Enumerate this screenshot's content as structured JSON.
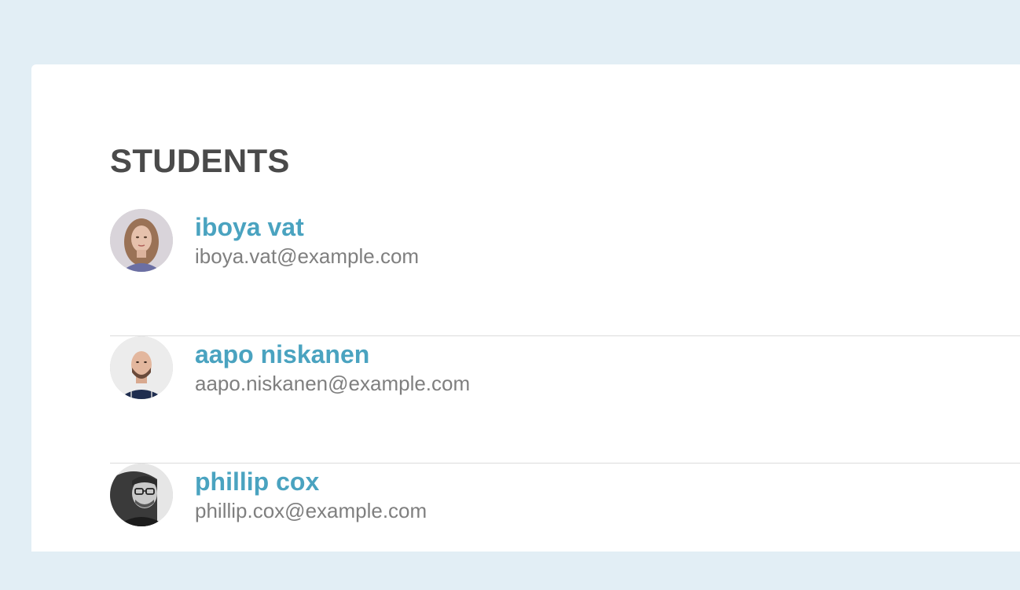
{
  "page": {
    "title": "STUDENTS"
  },
  "students": [
    {
      "name": "iboya vat",
      "email": "iboya.vat@example.com",
      "avatar_icon": "avatar-woman-photo"
    },
    {
      "name": "aapo niskanen",
      "email": "aapo.niskanen@example.com",
      "avatar_icon": "avatar-man-photo"
    },
    {
      "name": "phillip cox",
      "email": "phillip.cox@example.com",
      "avatar_icon": "avatar-man-glasses-photo"
    }
  ],
  "colors": {
    "background": "#e2eef5",
    "card": "#ffffff",
    "title": "#4a4a4a",
    "name_link": "#4aa3c0",
    "email": "#7f7f7f",
    "divider": "#dcdcdc"
  }
}
